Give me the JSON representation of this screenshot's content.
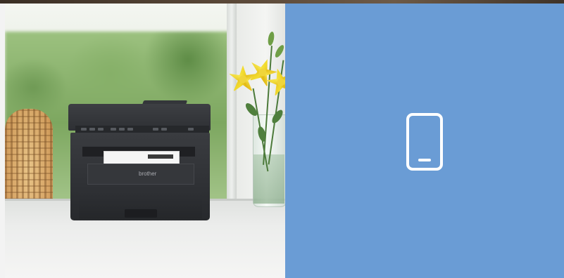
{
  "photo": {
    "printer_brand": "brother"
  },
  "panel": {
    "background_color": "#6a9cd5",
    "icon": "mobile-phone-icon",
    "icon_color": "#ffffff"
  }
}
